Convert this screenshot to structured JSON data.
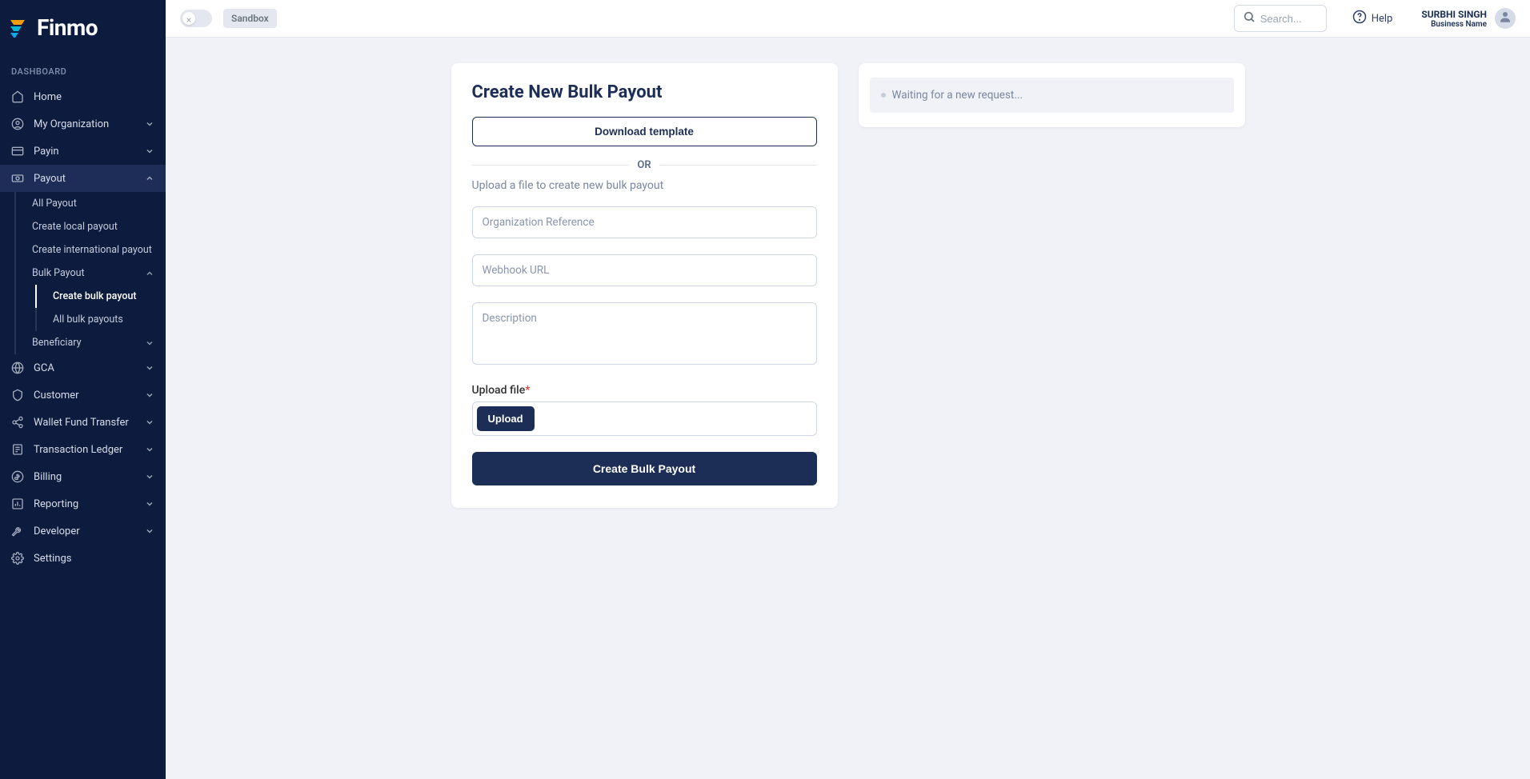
{
  "brand": {
    "name": "Finmo"
  },
  "sidebar": {
    "section": "DASHBOARD",
    "items": [
      {
        "label": "Home"
      },
      {
        "label": "My Organization"
      },
      {
        "label": "Payin"
      },
      {
        "label": "Payout"
      },
      {
        "label": "GCA"
      },
      {
        "label": "Customer"
      },
      {
        "label": "Wallet Fund Transfer"
      },
      {
        "label": "Transaction Ledger"
      },
      {
        "label": "Billing"
      },
      {
        "label": "Reporting"
      },
      {
        "label": "Developer"
      },
      {
        "label": "Settings"
      }
    ],
    "payout_sub": {
      "all": "All Payout",
      "local": "Create local payout",
      "intl": "Create international payout",
      "bulk": "Bulk Payout",
      "create_bulk": "Create bulk payout",
      "all_bulk": "All bulk payouts",
      "beneficiary": "Beneficiary"
    }
  },
  "topbar": {
    "sandbox": "Sandbox",
    "search_placeholder": "Search...",
    "help": "Help",
    "user_name": "SURBHI SINGH",
    "user_sub": "Business Name"
  },
  "form": {
    "title": "Create New Bulk Payout",
    "download": "Download template",
    "or": "OR",
    "helper": "Upload a file to create new bulk payout",
    "org_ref_placeholder": "Organization Reference",
    "webhook_placeholder": "Webhook URL",
    "desc_placeholder": "Description",
    "upload_label": "Upload file",
    "upload_btn": "Upload",
    "submit": "Create Bulk Payout"
  },
  "log": {
    "waiting": "Waiting for a new request..."
  }
}
